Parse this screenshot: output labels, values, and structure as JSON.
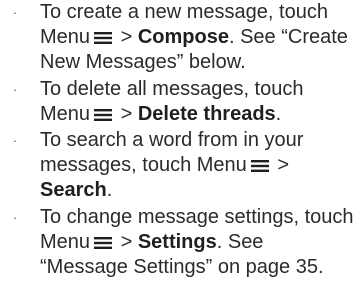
{
  "bullet_symbol": "·",
  "icon": "menu-icon",
  "items": [
    {
      "part1": "To create a new message, touch Menu",
      "part2": " > ",
      "command": "Compose",
      "part3": ". See “Create New Messages” below."
    },
    {
      "part1": "To delete all messages, touch Menu",
      "part2": " > ",
      "command": "Delete threads",
      "part3": "."
    },
    {
      "part1": "To search a word from in your messages, touch Menu",
      "part2": " > ",
      "command": "Search",
      "part3": "."
    },
    {
      "part1": "To change message settings, touch Menu",
      "part2": " > ",
      "command": "Settings",
      "part3": ". See “Message Settings” on page 35."
    }
  ]
}
